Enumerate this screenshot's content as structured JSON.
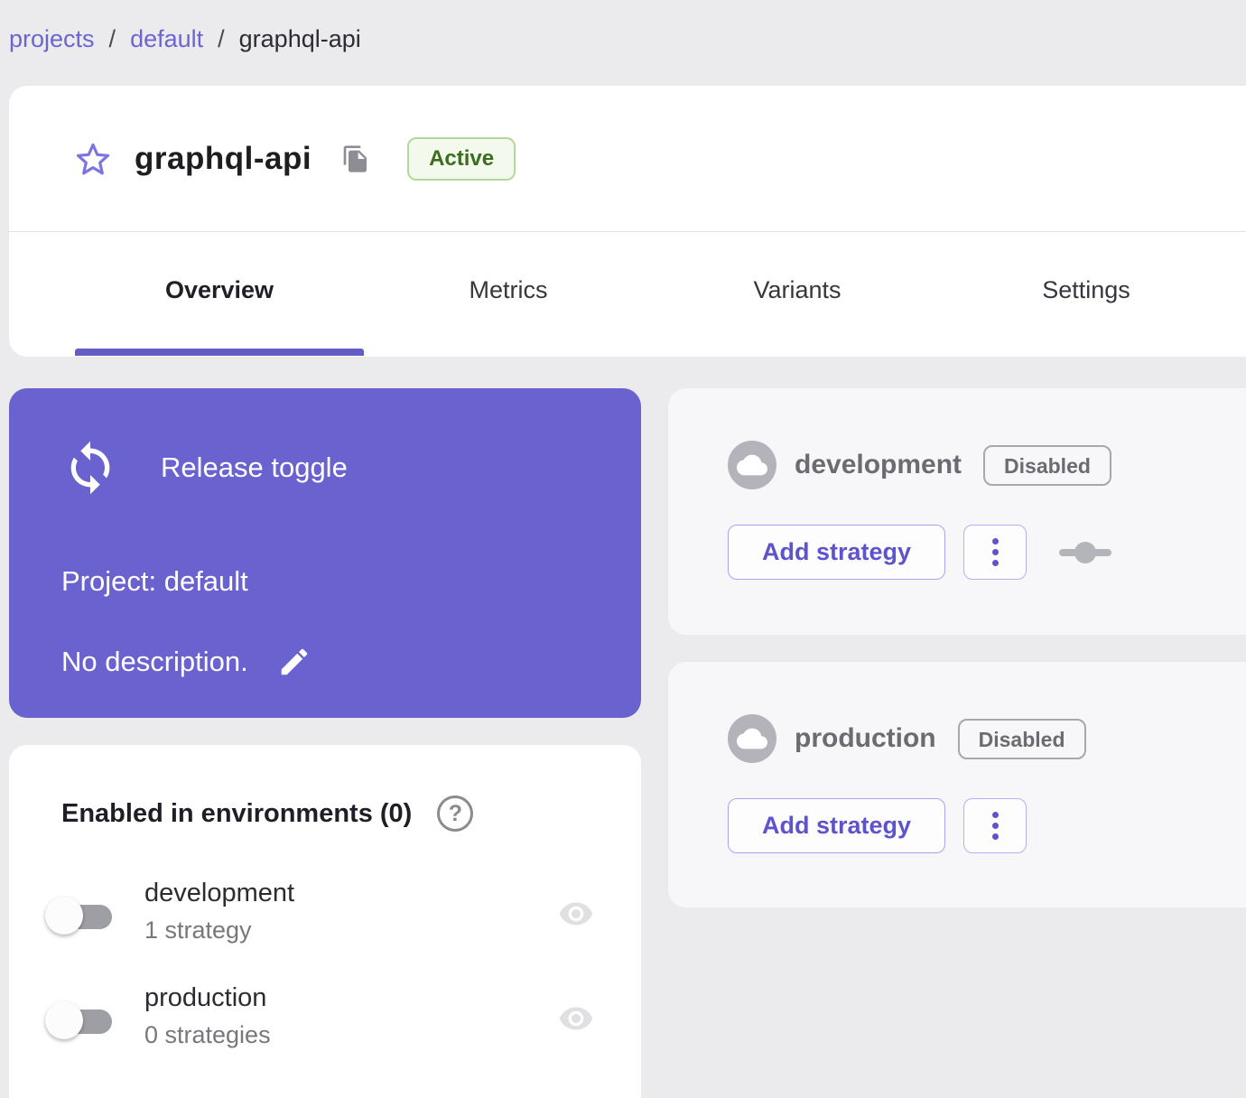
{
  "breadcrumb": {
    "separator": "/",
    "items": [
      {
        "label": "projects"
      },
      {
        "label": "default"
      },
      {
        "label": "graphql-api"
      }
    ]
  },
  "header": {
    "title": "graphql-api",
    "status_badge": "Active"
  },
  "tabs": [
    {
      "label": "Overview",
      "active": true
    },
    {
      "label": "Metrics",
      "active": false
    },
    {
      "label": "Variants",
      "active": false
    },
    {
      "label": "Settings",
      "active": false
    }
  ],
  "toggle_card": {
    "type_label": "Release toggle",
    "project_label": "Project: default",
    "description_label": "No description."
  },
  "environments_panel": {
    "title": "Enabled in environments (0)",
    "help_glyph": "?",
    "rows": [
      {
        "name": "development",
        "strategies": "1 strategy",
        "enabled": false
      },
      {
        "name": "production",
        "strategies": "0 strategies",
        "enabled": false
      }
    ]
  },
  "environment_cards": [
    {
      "name": "development",
      "status": "Disabled",
      "add_strategy_label": "Add strategy",
      "has_strategy_indicator": true
    },
    {
      "name": "production",
      "status": "Disabled",
      "add_strategy_label": "Add strategy",
      "has_strategy_indicator": false
    }
  ],
  "icons": {
    "star": "star-outline",
    "copy": "copy-pages",
    "sync": "circular-arrows",
    "edit": "pencil",
    "cloud": "cloud",
    "eye": "visibility",
    "kebab": "more-vertical",
    "strategy": "commit-slider"
  },
  "colors": {
    "accent": "#615bc8",
    "toggle_card_bg": "#6a63cf",
    "page_bg": "#ebebed",
    "active_badge_text": "#3c6e1f",
    "active_badge_bg": "#f3f9ec",
    "active_badge_border": "#b5d797"
  }
}
